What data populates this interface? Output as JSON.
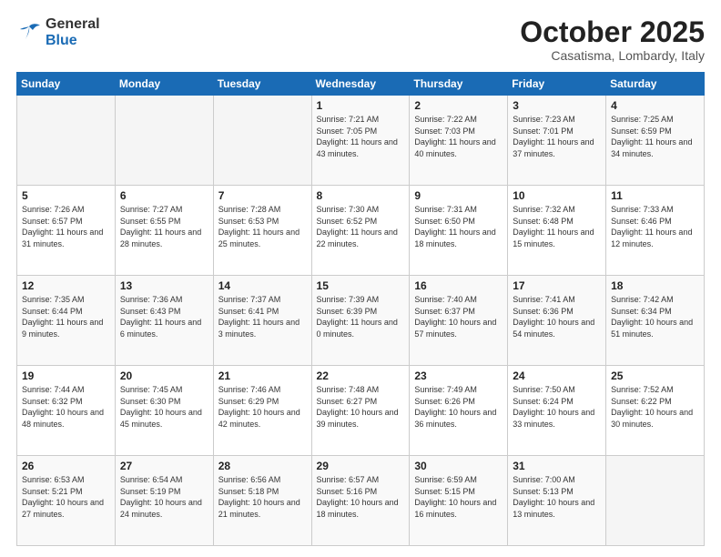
{
  "logo": {
    "general": "General",
    "blue": "Blue"
  },
  "header": {
    "month": "October 2025",
    "location": "Casatisma, Lombardy, Italy"
  },
  "weekdays": [
    "Sunday",
    "Monday",
    "Tuesday",
    "Wednesday",
    "Thursday",
    "Friday",
    "Saturday"
  ],
  "weeks": [
    [
      {
        "day": "",
        "info": ""
      },
      {
        "day": "",
        "info": ""
      },
      {
        "day": "",
        "info": ""
      },
      {
        "day": "1",
        "info": "Sunrise: 7:21 AM\nSunset: 7:05 PM\nDaylight: 11 hours\nand 43 minutes."
      },
      {
        "day": "2",
        "info": "Sunrise: 7:22 AM\nSunset: 7:03 PM\nDaylight: 11 hours\nand 40 minutes."
      },
      {
        "day": "3",
        "info": "Sunrise: 7:23 AM\nSunset: 7:01 PM\nDaylight: 11 hours\nand 37 minutes."
      },
      {
        "day": "4",
        "info": "Sunrise: 7:25 AM\nSunset: 6:59 PM\nDaylight: 11 hours\nand 34 minutes."
      }
    ],
    [
      {
        "day": "5",
        "info": "Sunrise: 7:26 AM\nSunset: 6:57 PM\nDaylight: 11 hours\nand 31 minutes."
      },
      {
        "day": "6",
        "info": "Sunrise: 7:27 AM\nSunset: 6:55 PM\nDaylight: 11 hours\nand 28 minutes."
      },
      {
        "day": "7",
        "info": "Sunrise: 7:28 AM\nSunset: 6:53 PM\nDaylight: 11 hours\nand 25 minutes."
      },
      {
        "day": "8",
        "info": "Sunrise: 7:30 AM\nSunset: 6:52 PM\nDaylight: 11 hours\nand 22 minutes."
      },
      {
        "day": "9",
        "info": "Sunrise: 7:31 AM\nSunset: 6:50 PM\nDaylight: 11 hours\nand 18 minutes."
      },
      {
        "day": "10",
        "info": "Sunrise: 7:32 AM\nSunset: 6:48 PM\nDaylight: 11 hours\nand 15 minutes."
      },
      {
        "day": "11",
        "info": "Sunrise: 7:33 AM\nSunset: 6:46 PM\nDaylight: 11 hours\nand 12 minutes."
      }
    ],
    [
      {
        "day": "12",
        "info": "Sunrise: 7:35 AM\nSunset: 6:44 PM\nDaylight: 11 hours\nand 9 minutes."
      },
      {
        "day": "13",
        "info": "Sunrise: 7:36 AM\nSunset: 6:43 PM\nDaylight: 11 hours\nand 6 minutes."
      },
      {
        "day": "14",
        "info": "Sunrise: 7:37 AM\nSunset: 6:41 PM\nDaylight: 11 hours\nand 3 minutes."
      },
      {
        "day": "15",
        "info": "Sunrise: 7:39 AM\nSunset: 6:39 PM\nDaylight: 11 hours\nand 0 minutes."
      },
      {
        "day": "16",
        "info": "Sunrise: 7:40 AM\nSunset: 6:37 PM\nDaylight: 10 hours\nand 57 minutes."
      },
      {
        "day": "17",
        "info": "Sunrise: 7:41 AM\nSunset: 6:36 PM\nDaylight: 10 hours\nand 54 minutes."
      },
      {
        "day": "18",
        "info": "Sunrise: 7:42 AM\nSunset: 6:34 PM\nDaylight: 10 hours\nand 51 minutes."
      }
    ],
    [
      {
        "day": "19",
        "info": "Sunrise: 7:44 AM\nSunset: 6:32 PM\nDaylight: 10 hours\nand 48 minutes."
      },
      {
        "day": "20",
        "info": "Sunrise: 7:45 AM\nSunset: 6:30 PM\nDaylight: 10 hours\nand 45 minutes."
      },
      {
        "day": "21",
        "info": "Sunrise: 7:46 AM\nSunset: 6:29 PM\nDaylight: 10 hours\nand 42 minutes."
      },
      {
        "day": "22",
        "info": "Sunrise: 7:48 AM\nSunset: 6:27 PM\nDaylight: 10 hours\nand 39 minutes."
      },
      {
        "day": "23",
        "info": "Sunrise: 7:49 AM\nSunset: 6:26 PM\nDaylight: 10 hours\nand 36 minutes."
      },
      {
        "day": "24",
        "info": "Sunrise: 7:50 AM\nSunset: 6:24 PM\nDaylight: 10 hours\nand 33 minutes."
      },
      {
        "day": "25",
        "info": "Sunrise: 7:52 AM\nSunset: 6:22 PM\nDaylight: 10 hours\nand 30 minutes."
      }
    ],
    [
      {
        "day": "26",
        "info": "Sunrise: 6:53 AM\nSunset: 5:21 PM\nDaylight: 10 hours\nand 27 minutes."
      },
      {
        "day": "27",
        "info": "Sunrise: 6:54 AM\nSunset: 5:19 PM\nDaylight: 10 hours\nand 24 minutes."
      },
      {
        "day": "28",
        "info": "Sunrise: 6:56 AM\nSunset: 5:18 PM\nDaylight: 10 hours\nand 21 minutes."
      },
      {
        "day": "29",
        "info": "Sunrise: 6:57 AM\nSunset: 5:16 PM\nDaylight: 10 hours\nand 18 minutes."
      },
      {
        "day": "30",
        "info": "Sunrise: 6:59 AM\nSunset: 5:15 PM\nDaylight: 10 hours\nand 16 minutes."
      },
      {
        "day": "31",
        "info": "Sunrise: 7:00 AM\nSunset: 5:13 PM\nDaylight: 10 hours\nand 13 minutes."
      },
      {
        "day": "",
        "info": ""
      }
    ]
  ]
}
